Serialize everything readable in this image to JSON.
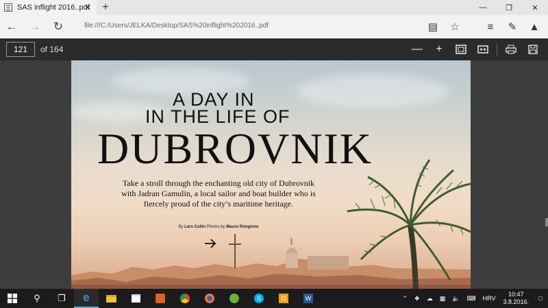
{
  "browser": {
    "tab_title": "SAS inflight 2016..pdf",
    "tab_close": "✕",
    "new_tab": "+",
    "url": "file:///C:/Users/JELKA/Desktop/SAS%20inflight%202016..pdf"
  },
  "pdf_toolbar": {
    "current_page": "121",
    "page_total": "of 164"
  },
  "pdf_page": {
    "headline_line1": "A DAY IN",
    "headline_line2": "IN THE LIFE OF",
    "title": "DUBROVNIK",
    "lede": "Take a stroll through the enchanting old city of Dubrovnik with Jadran Gamulin, a local sailor and boat builder who is fiercely proud of the city’s maritime heritage.",
    "byline_prefix": "By ",
    "byline_author": "Lars Collin",
    "byline_mid": " Photos by ",
    "byline_photographer": "Mauro Rongione"
  },
  "taskbar": {
    "language": "HRV",
    "time": "10:47",
    "date": "3.8.2016."
  },
  "colors": {
    "pdf_toolbar_bg": "#2b2b2b",
    "taskbar_bg": "#1b1b1b",
    "accent": "#1f6fd6"
  },
  "icons": [
    "back-icon",
    "forward-icon",
    "refresh-icon",
    "reading-view-icon",
    "favorite-star-icon",
    "hub-icon",
    "web-note-icon",
    "share-icon",
    "zoom-out-icon",
    "zoom-in-icon",
    "fit-page-icon",
    "fit-width-icon",
    "print-icon",
    "save-icon"
  ]
}
